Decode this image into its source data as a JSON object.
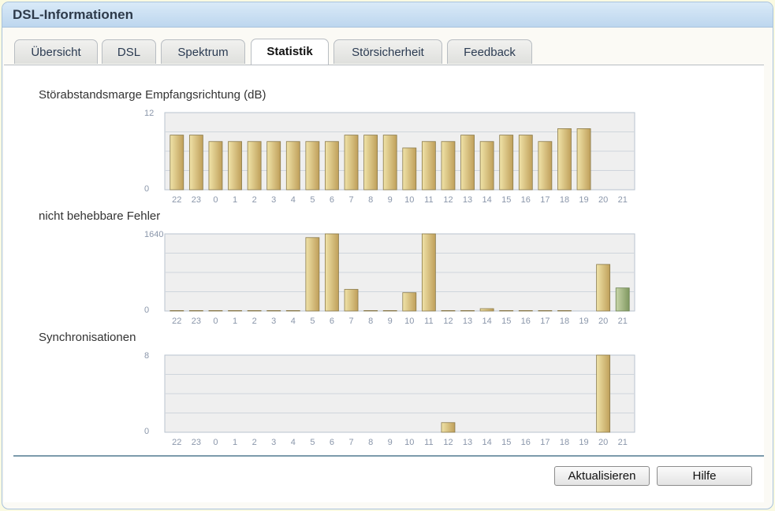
{
  "window": {
    "title": "DSL-Informationen"
  },
  "tabs": [
    {
      "label": "Übersicht",
      "active": false
    },
    {
      "label": "DSL",
      "active": false
    },
    {
      "label": "Spektrum",
      "active": false
    },
    {
      "label": "Statistik",
      "active": true
    },
    {
      "label": "Störsicherheit",
      "active": false
    },
    {
      "label": "Feedback",
      "active": false
    }
  ],
  "buttons": {
    "refresh": "Aktualisieren",
    "help": "Hilfe"
  },
  "colors": {
    "bar": "#d8c77e",
    "bar_current": "#9bb07a",
    "grid_bg": "#efefef",
    "accent": "#7c9bab"
  },
  "chart_data": [
    {
      "type": "bar",
      "title": "Störabstandsmarge Empfangsrichtung (dB)",
      "categories": [
        "22",
        "23",
        "0",
        "1",
        "2",
        "3",
        "4",
        "5",
        "6",
        "7",
        "8",
        "9",
        "10",
        "11",
        "12",
        "13",
        "14",
        "15",
        "16",
        "17",
        "18",
        "19",
        "20",
        "21"
      ],
      "values": [
        8.5,
        8.5,
        7.5,
        7.5,
        7.5,
        7.5,
        7.5,
        7.5,
        7.5,
        8.5,
        8.5,
        8.5,
        6.5,
        7.5,
        7.5,
        8.5,
        7.5,
        8.5,
        8.5,
        7.5,
        9.5,
        9.5,
        0,
        0
      ],
      "ylim": [
        0,
        12
      ],
      "yticks": [
        "0",
        "12"
      ],
      "grid": true
    },
    {
      "type": "bar",
      "title": "nicht behebbare Fehler",
      "categories": [
        "22",
        "23",
        "0",
        "1",
        "2",
        "3",
        "4",
        "5",
        "6",
        "7",
        "8",
        "9",
        "10",
        "11",
        "12",
        "13",
        "14",
        "15",
        "16",
        "17",
        "18",
        "19",
        "20",
        "21"
      ],
      "values": [
        10,
        10,
        10,
        10,
        10,
        10,
        10,
        1560,
        1660,
        460,
        10,
        10,
        390,
        1680,
        10,
        10,
        50,
        10,
        10,
        10,
        10,
        0,
        990,
        490
      ],
      "highlight_last": true,
      "ylim": [
        0,
        1640
      ],
      "yticks": [
        "0",
        "1640"
      ],
      "grid": true
    },
    {
      "type": "bar",
      "title": "Synchronisationen",
      "categories": [
        "22",
        "23",
        "0",
        "1",
        "2",
        "3",
        "4",
        "5",
        "6",
        "7",
        "8",
        "9",
        "10",
        "11",
        "12",
        "13",
        "14",
        "15",
        "16",
        "17",
        "18",
        "19",
        "20",
        "21"
      ],
      "values": [
        0,
        0,
        0,
        0,
        0,
        0,
        0,
        0,
        0,
        0,
        0,
        0,
        0,
        0,
        1,
        0,
        0,
        0,
        0,
        0,
        0,
        0,
        8,
        0
      ],
      "ylim": [
        0,
        8
      ],
      "yticks": [
        "0",
        "8"
      ],
      "grid": true
    }
  ]
}
